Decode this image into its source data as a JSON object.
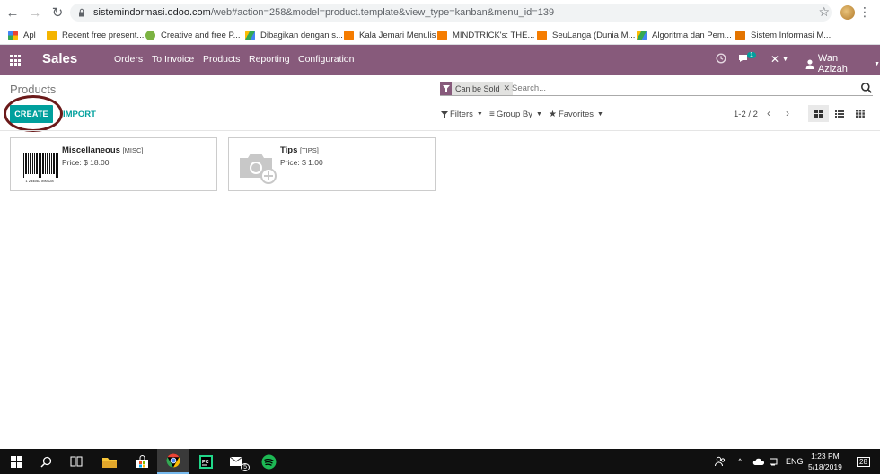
{
  "browser": {
    "url_host": "sistemindormasi.odoo.com",
    "url_path": "/web#action=258&model=product.template&view_type=kanban&menu_id=139",
    "bookmarks": [
      {
        "label": "Apl",
        "color": "#4285f4"
      },
      {
        "label": "Recent free present...",
        "color": "#f4b400"
      },
      {
        "label": "Creative and free P...",
        "color": "#34a853"
      },
      {
        "label": "Dibagikan dengan s...",
        "color": "#fbbc05"
      },
      {
        "label": "Kala Jemari Menulis",
        "color": "#f57c00"
      },
      {
        "label": "MINDTRICK's: THE...",
        "color": "#f57c00"
      },
      {
        "label": "SeuLanga (Dunia M...",
        "color": "#f57c00"
      },
      {
        "label": "Algoritma dan Pem...",
        "color": "#34a853"
      },
      {
        "label": "Sistem Informasi M...",
        "color": "#e37400"
      }
    ]
  },
  "odoo": {
    "app_name": "Sales",
    "menu": [
      "Orders",
      "To Invoice",
      "Products",
      "Reporting",
      "Configuration"
    ],
    "message_count": "1",
    "user": "Wan Azizah",
    "accent": "#875a7b",
    "primary": "#00a09d"
  },
  "control": {
    "breadcrumb": "Products",
    "facet": "Can be Sold",
    "search_placeholder": "Search...",
    "create_label": "CREATE",
    "import_label": "IMPORT",
    "filters_label": "Filters",
    "groupby_label": "Group By",
    "favorites_label": "Favorites",
    "pager": "1-2 / 2"
  },
  "products": [
    {
      "name": "Miscellaneous",
      "code": "[MISC]",
      "price": "Price: $ 18.00",
      "image": "barcode-image",
      "barcode_text": "1 234567 890128"
    },
    {
      "name": "Tips",
      "code": "[TIPS]",
      "price": "Price: $ 1.00",
      "image": "camera-placeholder"
    }
  ],
  "taskbar": {
    "time": "1:23 PM",
    "date": "5/18/2019",
    "lang": "ENG",
    "notif": "28",
    "mail_badge": "5"
  }
}
